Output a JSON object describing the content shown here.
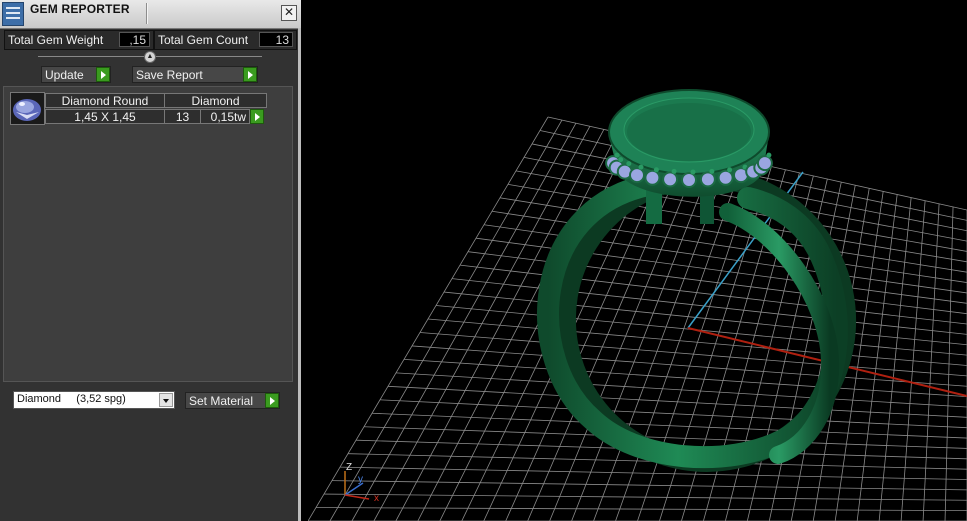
{
  "panel": {
    "title": "GEM REPORTER",
    "close_glyph": "✕",
    "stats": {
      "weight_label": "Total Gem Weight",
      "weight_value": ",15",
      "count_label": "Total Gem Count",
      "count_value": "13"
    },
    "update_label": "Update",
    "save_report_label": "Save Report",
    "collapse_glyph": "▲",
    "gem_rows": [
      {
        "thumb_icon": "gem-preview-icon",
        "name": "Diamond Round",
        "material": "Diamond",
        "size": "1,45 X 1,45",
        "count": "13",
        "weight": "0,15tw"
      }
    ],
    "material_select": "Diamond     (3,52 spg)",
    "set_material_label": "Set Material"
  },
  "viewport": {
    "axes": {
      "z": "Z",
      "y": "y",
      "x": "x"
    }
  },
  "colors": {
    "ring": "#1d7a4c",
    "gem_blue": "#9aa6e0",
    "grid": "#8a8a8a",
    "axis_x": "#b02010",
    "axis_y": "#3aa0c8",
    "go_button": "#3a9b1f"
  }
}
